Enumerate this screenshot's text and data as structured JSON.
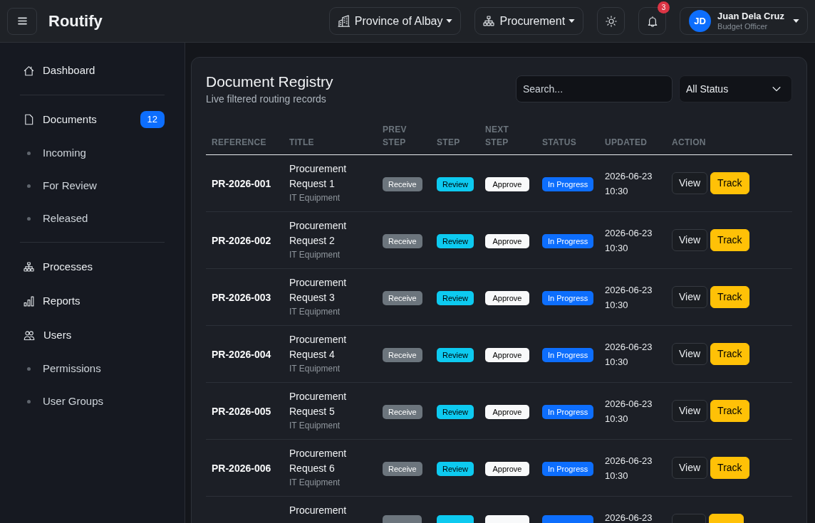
{
  "topbar": {
    "brand": "Routify",
    "organization": "Province of Albay",
    "department": "Procurement",
    "notifications": "3",
    "user": {
      "initials": "JD",
      "name": "Juan Dela Cruz",
      "role": "Budget Officer"
    }
  },
  "sidebar": {
    "sections": [
      {
        "items": [
          {
            "label": "Dashboard"
          }
        ]
      },
      {
        "items": [
          {
            "label": "Documents",
            "badge": "12",
            "children": [
              {
                "label": "Incoming"
              },
              {
                "label": "For Review"
              },
              {
                "label": "Released"
              }
            ]
          }
        ]
      },
      {
        "items": [
          {
            "label": "Processes"
          },
          {
            "label": "Reports"
          },
          {
            "label": "Users",
            "children": [
              {
                "label": "Permissions"
              },
              {
                "label": "User Groups"
              }
            ]
          }
        ]
      }
    ]
  },
  "registry": {
    "title": "Document Registry",
    "subtitle": "Live filtered routing records",
    "search": {
      "placeholder": "Search..."
    },
    "status_filter": {
      "value": "All Status"
    },
    "table": {
      "columns": [
        "REFERENCE",
        "TITLE",
        "PREV STEP",
        "STEP",
        "NEXT STEP",
        "STATUS",
        "UPDATED",
        "ACTION"
      ],
      "rows": [
        {
          "reference": "PR-2026-001",
          "title": "Procurement Request 1",
          "category": "IT Equipment",
          "prev_step": "Receive",
          "step": "Review",
          "next_step": "Approve",
          "status": "In Progress",
          "updated": "2026-06-23 10:30",
          "actions": [
            {
              "label": "View",
              "kind": "outline"
            },
            {
              "label": "Track",
              "kind": "warning"
            }
          ]
        },
        {
          "reference": "PR-2026-002",
          "title": "Procurement Request 2",
          "category": "IT Equipment",
          "prev_step": "Receive",
          "step": "Review",
          "next_step": "Approve",
          "status": "In Progress",
          "updated": "2026-06-23 10:30",
          "actions": [
            {
              "label": "View",
              "kind": "outline"
            },
            {
              "label": "Track",
              "kind": "warning"
            }
          ]
        },
        {
          "reference": "PR-2026-003",
          "title": "Procurement Request 3",
          "category": "IT Equipment",
          "prev_step": "Receive",
          "step": "Review",
          "next_step": "Approve",
          "status": "In Progress",
          "updated": "2026-06-23 10:30",
          "actions": [
            {
              "label": "View",
              "kind": "outline"
            },
            {
              "label": "Track",
              "kind": "warning"
            }
          ]
        },
        {
          "reference": "PR-2026-004",
          "title": "Procurement Request 4",
          "category": "IT Equipment",
          "prev_step": "Receive",
          "step": "Review",
          "next_step": "Approve",
          "status": "In Progress",
          "updated": "2026-06-23 10:30",
          "actions": [
            {
              "label": "View",
              "kind": "outline"
            },
            {
              "label": "Track",
              "kind": "warning"
            }
          ]
        },
        {
          "reference": "PR-2026-005",
          "title": "Procurement Request 5",
          "category": "IT Equipment",
          "prev_step": "Receive",
          "step": "Review",
          "next_step": "Approve",
          "status": "In Progress",
          "updated": "2026-06-23 10:30",
          "actions": [
            {
              "label": "View",
              "kind": "outline"
            },
            {
              "label": "Track",
              "kind": "warning"
            }
          ]
        },
        {
          "reference": "PR-2026-006",
          "title": "Procurement Request 6",
          "category": "IT Equipment",
          "prev_step": "Receive",
          "step": "Review",
          "next_step": "Approve",
          "status": "In Progress",
          "updated": "2026-06-23 10:30",
          "actions": [
            {
              "label": "View",
              "kind": "outline"
            },
            {
              "label": "Track",
              "kind": "warning"
            }
          ]
        },
        {
          "title": "Procurement",
          "updated": "2026-06-23",
          "actions": [
            {
              "kind": "outline"
            },
            {
              "kind": "warning"
            }
          ]
        }
      ]
    }
  }
}
